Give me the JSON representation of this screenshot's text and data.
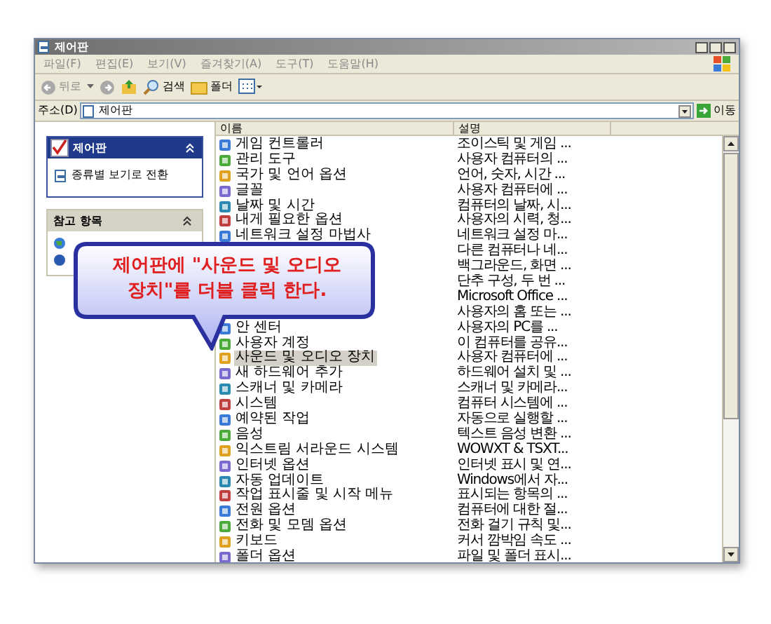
{
  "window": {
    "title": "제어판"
  },
  "menu": [
    "파일(F)",
    "편집(E)",
    "보기(V)",
    "즐겨찾기(A)",
    "도구(T)",
    "도움말(H)"
  ],
  "toolbar": {
    "back": "뒤로",
    "search": "검색",
    "folders": "폴더"
  },
  "address": {
    "label": "주소(D)",
    "value": "제어판",
    "go": "이동"
  },
  "task_pane": {
    "title": "제어판",
    "expanded": true,
    "link": "종류별 보기로 전환",
    "see_also_title": "참고 항목"
  },
  "columns": [
    "이름",
    "설명"
  ],
  "rows": [
    {
      "name": "게임 컨트롤러",
      "description": "조이스틱 및 게임 ...",
      "selected": false
    },
    {
      "name": "관리 도구",
      "description": "사용자 컴퓨터의 ...",
      "selected": false
    },
    {
      "name": "국가 및 언어 옵션",
      "description": "언어, 숫자, 시간 ...",
      "selected": false
    },
    {
      "name": "글꼴",
      "description": "사용자 컴퓨터에 ...",
      "selected": false
    },
    {
      "name": "날짜 및 시간",
      "description": "컴퓨터의 날짜, 시...",
      "selected": false
    },
    {
      "name": "내게 필요한 옵션",
      "description": "사용자의 시력, 청...",
      "selected": false
    },
    {
      "name": "네트워크 설정 마법사",
      "description": "네트워크 설정 마...",
      "selected": false
    },
    {
      "description": "다른 컴퓨터나 네...",
      "selected": false
    },
    {
      "description": "백그라운드, 화면 ...",
      "selected": false
    },
    {
      "description": "단추 구성, 두 번 ...",
      "selected": false
    },
    {
      "description": "Microsoft Office ...",
      "selected": false
    },
    {
      "description": "사용자의 홈 또는 ...",
      "selected": false
    },
    {
      "name": "안 센터",
      "description": "사용자의 PC를 ...",
      "selected": false
    },
    {
      "name": "사용자 계정",
      "description": "이 컴퓨터를 공유...",
      "selected": false
    },
    {
      "name": "사운드 및 오디오 장치",
      "description": "사용자 컴퓨터에 ...",
      "selected": true
    },
    {
      "name": "새 하드웨어 추가",
      "description": "하드웨어 설치 및 ...",
      "selected": false
    },
    {
      "name": "스캐너 및 카메라",
      "description": "스캐너 및 카메라...",
      "selected": false
    },
    {
      "name": "시스템",
      "description": "컴퓨터 시스템에 ...",
      "selected": false
    },
    {
      "name": "예약된 작업",
      "description": "자동으로 실행할 ...",
      "selected": false
    },
    {
      "name": "음성",
      "description": "텍스트 음성 변환 ...",
      "selected": false
    },
    {
      "name": "익스트림 서라운드 시스템",
      "description": "WOWXT & TSXT...",
      "selected": false
    },
    {
      "name": "인터넷 옵션",
      "description": "인터넷 표시 및 연...",
      "selected": false
    },
    {
      "name": "자동 업데이트",
      "description": "Windows에서 자...",
      "selected": false
    },
    {
      "name": "작업 표시줄 및 시작 메뉴",
      "description": "표시되는 항목의 ...",
      "selected": false
    },
    {
      "name": "전원 옵션",
      "description": "컴퓨터에 대한 절...",
      "selected": false
    },
    {
      "name": "전화 및 모뎀 옵션",
      "description": "전화 걸기 규칙 및...",
      "selected": false
    },
    {
      "name": "키보드",
      "description": "커서 깜박임 속도 ...",
      "selected": false
    },
    {
      "name": "폴더 옵션",
      "description": "파일 및 폴더 표시...",
      "selected": false
    }
  ],
  "callout": {
    "lines": [
      "제어판에 \"사운드 및 오디오",
      "장치\"를 더블 클릭 한다."
    ]
  }
}
